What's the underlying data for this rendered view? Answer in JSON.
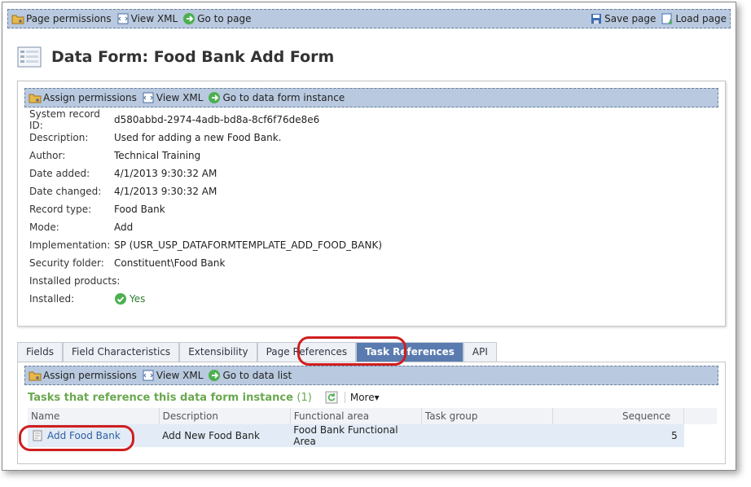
{
  "top_toolbar": {
    "page_permissions": "Page permissions",
    "view_xml": "View XML",
    "go_to_page": "Go to page",
    "save_page": "Save page",
    "load_page": "Load page"
  },
  "page_title": "Data Form: Food Bank Add Form",
  "details_toolbar": {
    "assign_permissions": "Assign permissions",
    "view_xml": "View XML",
    "go_to_instance": "Go to data form instance"
  },
  "properties": [
    {
      "label": "System record ID:",
      "value": "d580abbd-2974-4adb-bd8a-8cf6f76de8e6"
    },
    {
      "label": "Description:",
      "value": "Used for adding a new Food Bank."
    },
    {
      "label": "Author:",
      "value": "Technical Training"
    },
    {
      "label": "Date added:",
      "value": "4/1/2013 9:30:32 AM"
    },
    {
      "label": "Date changed:",
      "value": "4/1/2013 9:30:32 AM"
    },
    {
      "label": "Record type:",
      "value": "Food Bank"
    },
    {
      "label": "Mode:",
      "value": "Add"
    },
    {
      "label": "Implementation:",
      "value": "SP (USR_USP_DATAFORMTEMPLATE_ADD_FOOD_BANK)"
    },
    {
      "label": "Security folder:",
      "value": "Constituent\\Food Bank"
    },
    {
      "label": "Installed products:",
      "value": ""
    },
    {
      "label": "Installed:",
      "value": "Yes"
    }
  ],
  "tabs": [
    "Fields",
    "Field Characteristics",
    "Extensibility",
    "Page References",
    "Task References",
    "API"
  ],
  "active_tab": "Task References",
  "tab_toolbar": {
    "assign_permissions": "Assign permissions",
    "view_xml": "View XML",
    "go_to_data_list": "Go to data list"
  },
  "section": {
    "title": "Tasks that reference this data form instance",
    "count": "(1)",
    "more": "More"
  },
  "table": {
    "columns": [
      "Name",
      "Description",
      "Functional area",
      "Task group",
      "Sequence"
    ],
    "rows": [
      {
        "name": "Add Food Bank",
        "description": "Add New Food Bank",
        "functional_area": "Food Bank Functional Area",
        "task_group": "",
        "sequence": "5"
      }
    ]
  },
  "colors": {
    "toolbar_bg": "#b9c9df",
    "active_tab": "#5a7bb0",
    "section_title": "#6aa84f",
    "link": "#2d5fa0",
    "highlight_ring": "#d01e1e"
  }
}
